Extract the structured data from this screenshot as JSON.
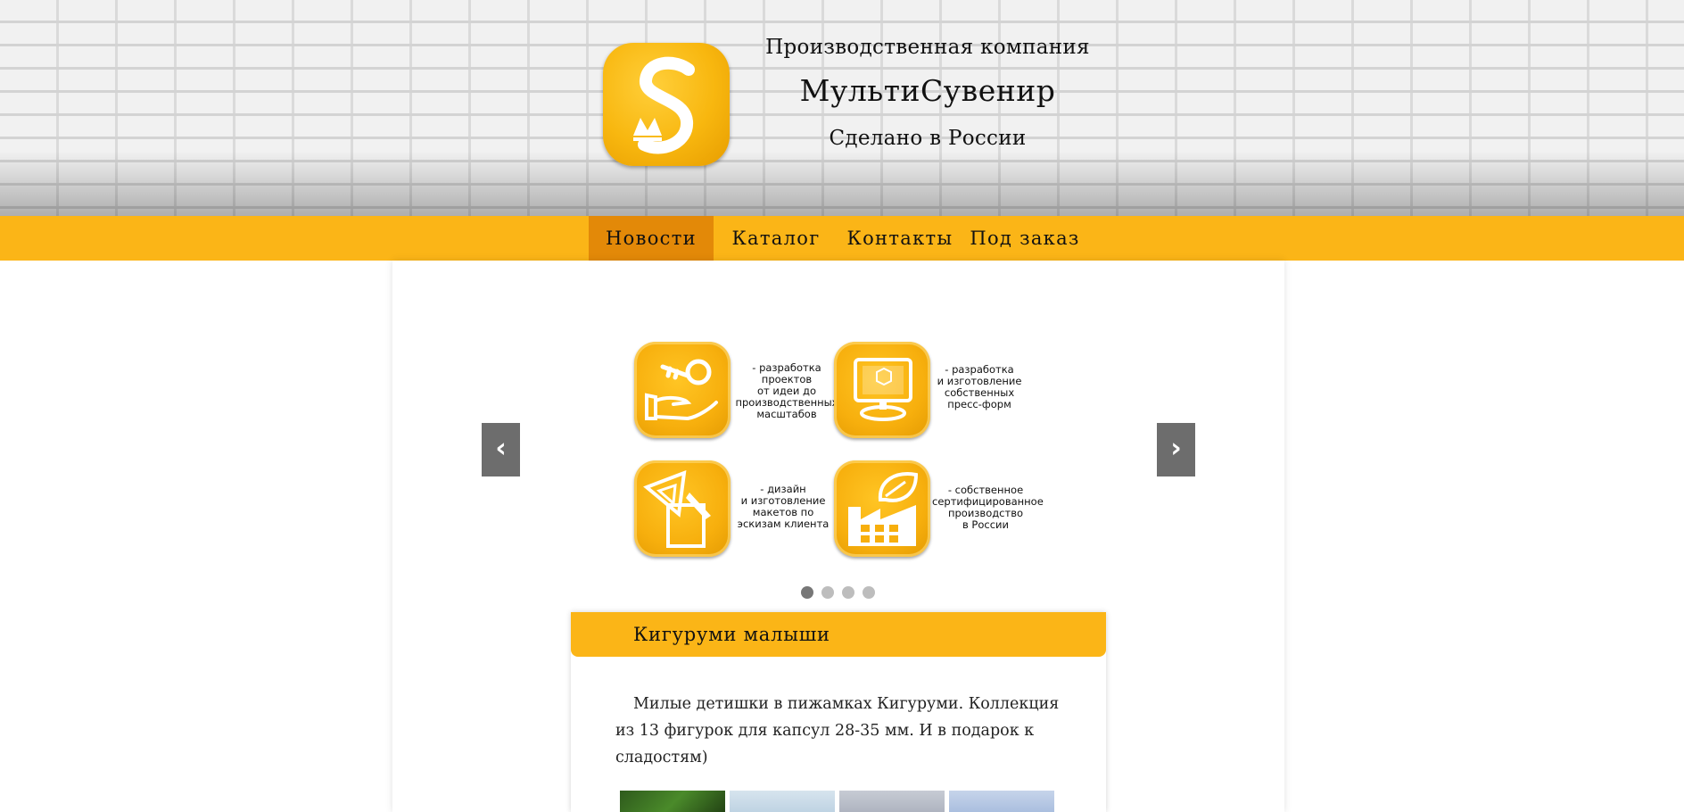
{
  "header": {
    "tagline": "Производственная компания",
    "brand": "МультиСувенир",
    "made_in": "Сделано в России",
    "logo_letters": "S M"
  },
  "nav": {
    "items": [
      {
        "label": "Новости",
        "active": true
      },
      {
        "label": "Каталог",
        "active": false
      },
      {
        "label": "Контакты",
        "active": false
      },
      {
        "label": "Под заказ",
        "active": false
      }
    ]
  },
  "slider": {
    "prev_label": "‹",
    "next_label": "›",
    "features": [
      {
        "icon": "hand-key-icon",
        "text": "- разработка\nпроектов\nот идеи до\nпроизводственных\nмасштабов"
      },
      {
        "icon": "monitor-icon",
        "text": "- разработка\nи изготовление\nсобственных\nпресс-форм"
      },
      {
        "icon": "drafting-tools-icon",
        "text": "- дизайн\nи изготовление\nмакетов по\nэскизам клиента"
      },
      {
        "icon": "factory-leaf-icon",
        "text": "- собственное\nсертифицированное\nпроизводство\nв России"
      }
    ],
    "dots_count": 4,
    "active_dot": 0
  },
  "news": {
    "title": "Кигуруми малыши",
    "text": "Милые детишки в пижамках Кигуруми. Коллекция из 13 фигурок для капсул 28-35 мм. И в подарок к сладостям)"
  },
  "colors": {
    "accent": "#fbb517",
    "accent_dark": "#e38908",
    "slider_button": "#6d6d6d"
  }
}
